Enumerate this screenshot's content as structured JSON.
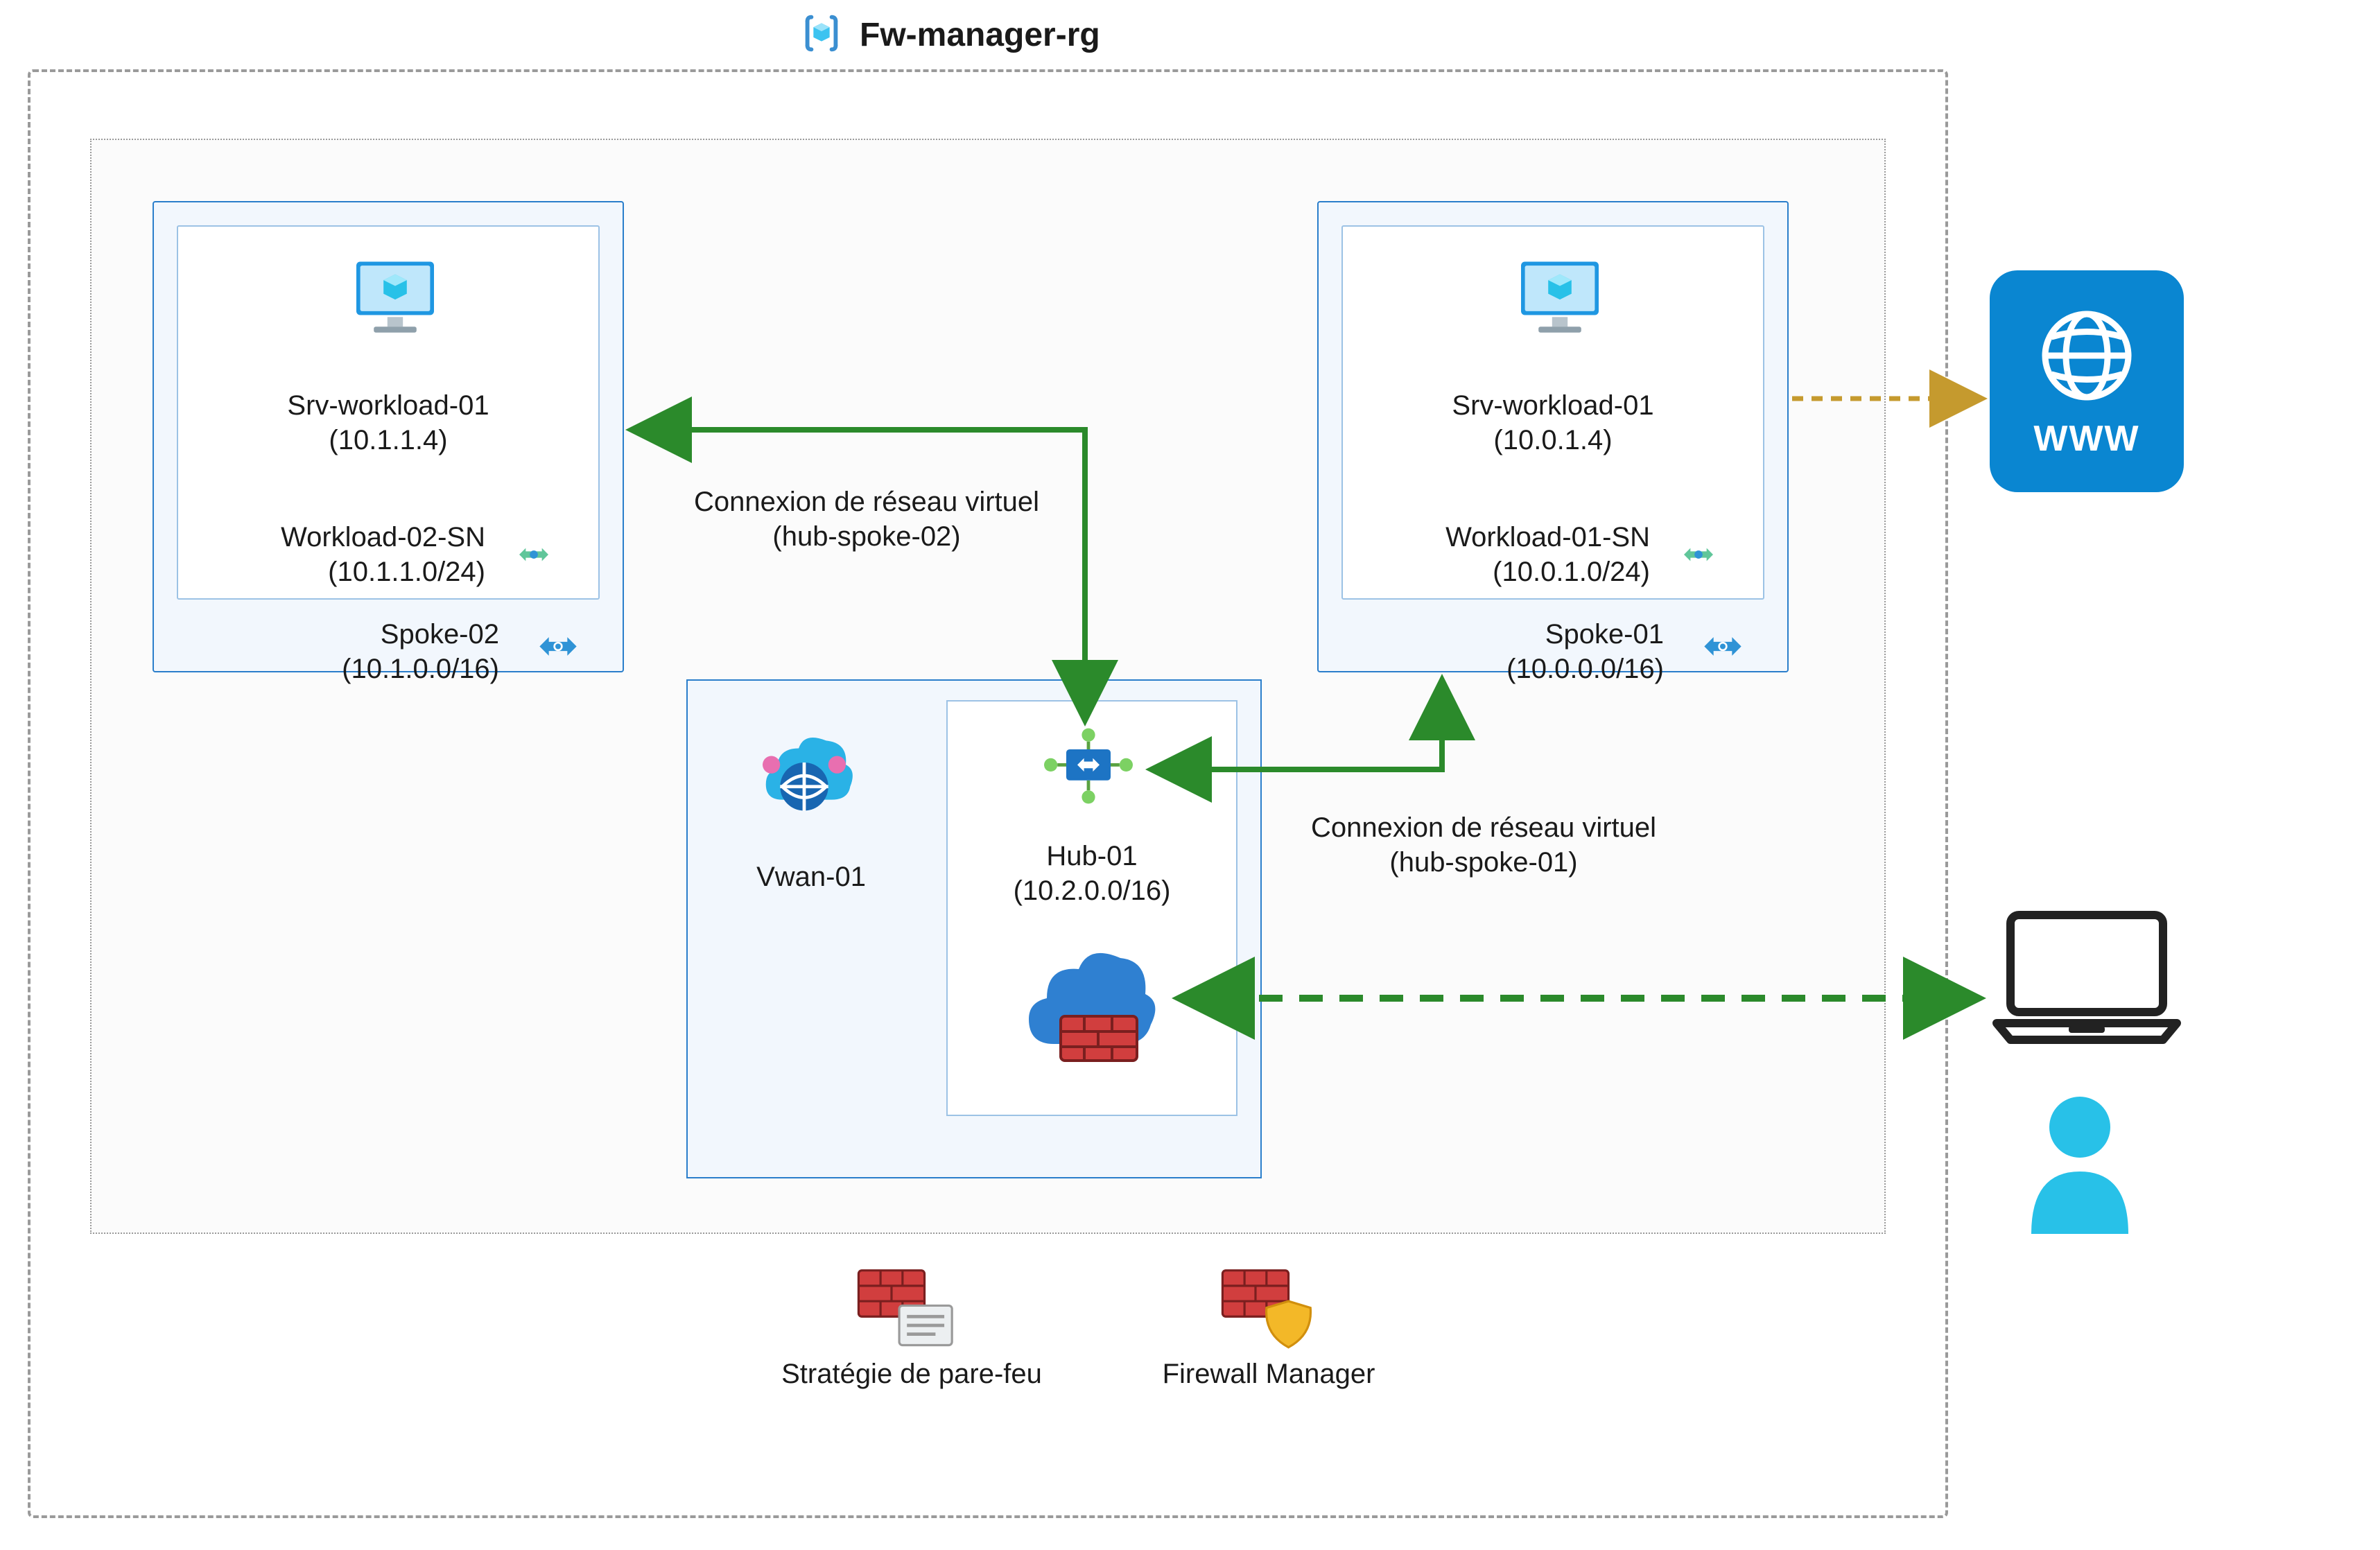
{
  "resource_group": {
    "title": "Fw-manager-rg"
  },
  "spoke02": {
    "vm_name": "Srv-workload-01",
    "vm_ip": "(10.1.1.4)",
    "subnet_name": "Workload-02-SN",
    "subnet_cidr": "(10.1.1.0/24)",
    "vnet_name": "Spoke-02",
    "vnet_cidr": "(10.1.0.0/16)"
  },
  "spoke01": {
    "vm_name": "Srv-workload-01",
    "vm_ip": "(10.0.1.4)",
    "subnet_name": "Workload-01-SN",
    "subnet_cidr": "(10.0.1.0/24)",
    "vnet_name": "Spoke-01",
    "vnet_cidr": "(10.0.0.0/16)"
  },
  "vwan": {
    "name": "Vwan-01",
    "hub_name": "Hub-01",
    "hub_cidr": "(10.2.0.0/16)"
  },
  "connections": {
    "hub_spoke_02_line1": "Connexion de réseau virtuel",
    "hub_spoke_02_line2": "(hub-spoke-02)",
    "hub_spoke_01_line1": "Connexion de réseau virtuel",
    "hub_spoke_01_line2": "(hub-spoke-01)"
  },
  "legend": {
    "firewall_policy": "Stratégie de pare-feu",
    "firewall_manager": "Firewall Manager"
  },
  "external": {
    "www_label": "WWW"
  }
}
